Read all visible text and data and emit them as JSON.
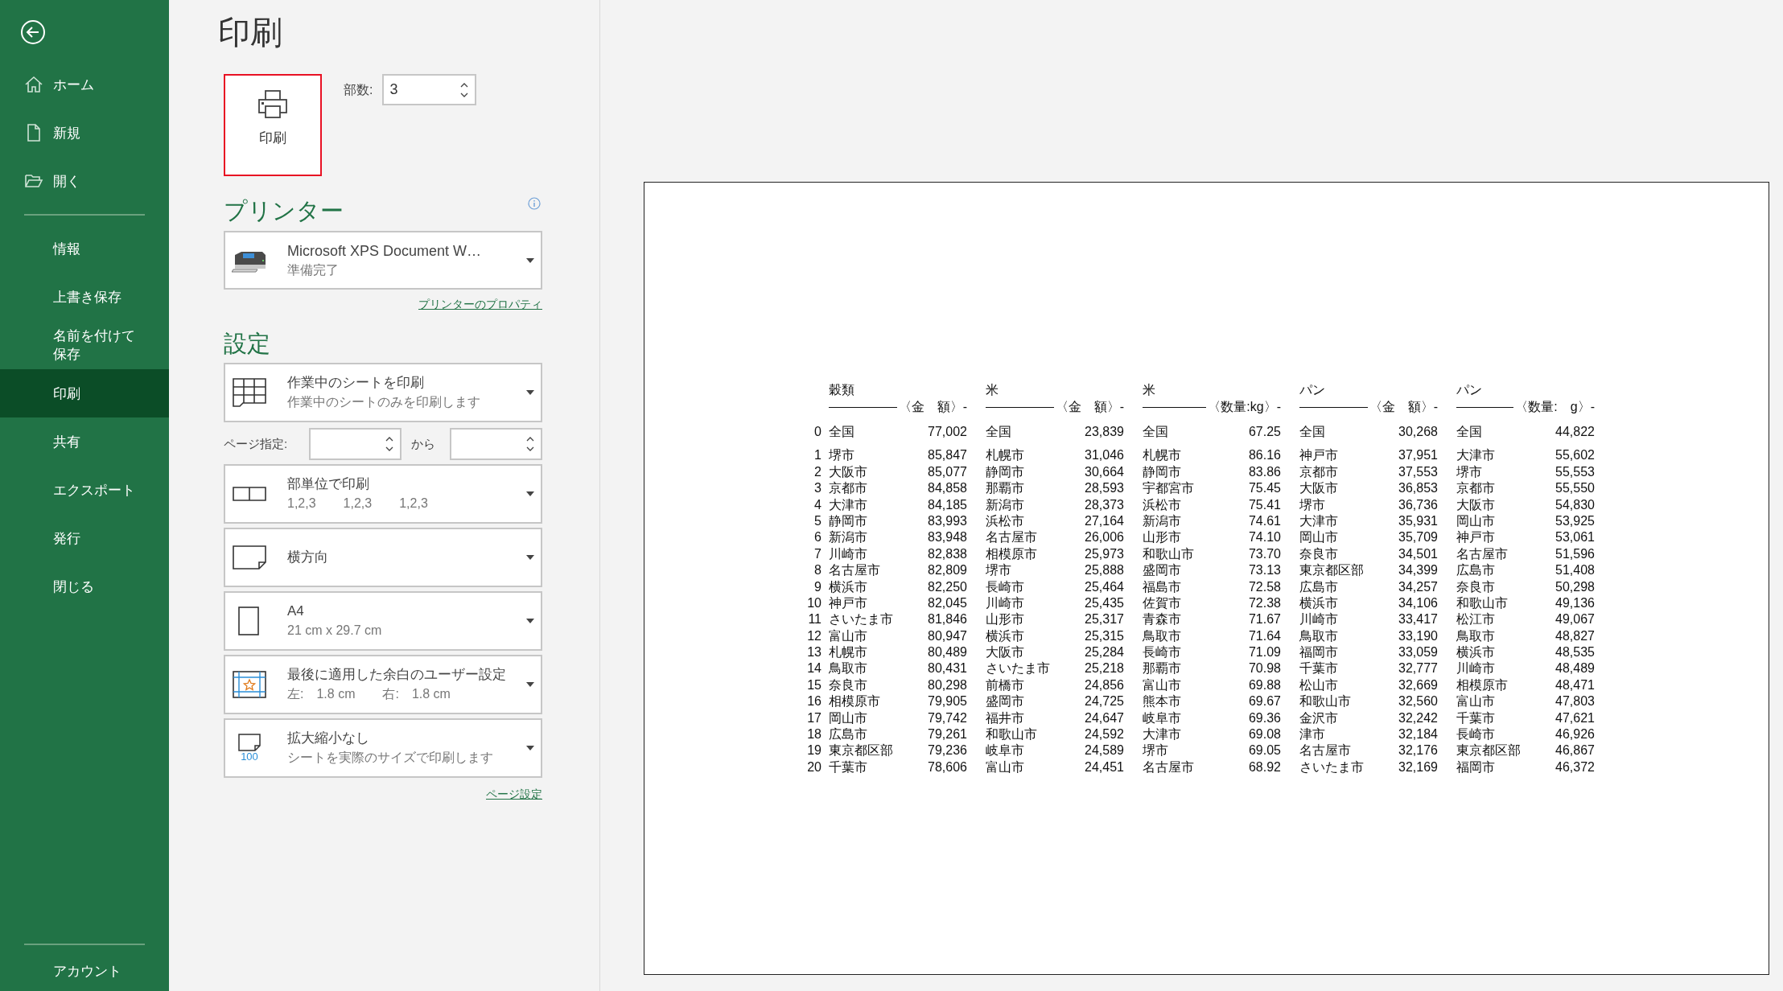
{
  "sidebar": {
    "top_items": [
      {
        "label": "ホーム",
        "kind": "home",
        "selected": false
      },
      {
        "label": "新規",
        "kind": "new",
        "selected": false
      },
      {
        "label": "開く",
        "kind": "open",
        "selected": false
      }
    ],
    "items": [
      {
        "label": "情報",
        "selected": false
      },
      {
        "label": "上書き保存",
        "selected": false
      },
      {
        "label": "名前を付けて保存",
        "selected": false
      },
      {
        "label": "印刷",
        "selected": true
      },
      {
        "label": "共有",
        "selected": false
      },
      {
        "label": "エクスポート",
        "selected": false
      },
      {
        "label": "発行",
        "selected": false
      },
      {
        "label": "閉じる",
        "selected": false
      }
    ],
    "account": "アカウント"
  },
  "title": "印刷",
  "print_button": {
    "label": "印刷"
  },
  "copies": {
    "label": "部数:",
    "value": "3"
  },
  "printer": {
    "heading": "プリンター",
    "name": "Microsoft XPS Document W…",
    "status": "準備完了",
    "properties_link": "プリンターのプロパティ"
  },
  "settings": {
    "heading": "設定",
    "items": [
      {
        "kind": "sheet",
        "title": "作業中のシートを印刷",
        "details": [
          "作業中のシートのみを印刷します"
        ]
      },
      {
        "kind": "range",
        "label": "ページ指定:",
        "separator": "から"
      },
      {
        "kind": "collate",
        "title": "部単位で印刷",
        "details": [
          "1,2,3",
          "1,2,3",
          "1,2,3"
        ]
      },
      {
        "kind": "orientation",
        "title": "横方向"
      },
      {
        "kind": "paper",
        "title": "A4",
        "details": [
          "21 cm x 29.7 cm"
        ]
      },
      {
        "kind": "margins",
        "title": "最後に適用した余白のユーザー設定",
        "details": [
          "左:　1.8 cm",
          "右:　1.8 cm"
        ]
      },
      {
        "kind": "scaling",
        "title": "拡大縮小なし",
        "details": [
          "シートを実際のサイズで印刷します"
        ],
        "badge": "100"
      }
    ],
    "page_setup_link": "ページ設定"
  },
  "preview": {
    "groups": [
      {
        "title": "穀類",
        "measure": "〈金　額〉-"
      },
      {
        "title": "米",
        "measure": "〈金　額〉-"
      },
      {
        "title": "米",
        "measure": "〈数量:kg〉-"
      },
      {
        "title": "パン",
        "measure": "〈金　額〉-"
      },
      {
        "title": "パン",
        "measure": "〈数量:　g〉-"
      }
    ],
    "total": {
      "no": "0",
      "cells": [
        [
          "全国",
          "77,002"
        ],
        [
          "全国",
          "23,839"
        ],
        [
          "全国",
          "67.25"
        ],
        [
          "全国",
          "30,268"
        ],
        [
          "全国",
          "44,822"
        ]
      ]
    },
    "rows": [
      {
        "no": "1",
        "cells": [
          [
            "堺市",
            "85,847"
          ],
          [
            "札幌市",
            "31,046"
          ],
          [
            "札幌市",
            "86.16"
          ],
          [
            "神戸市",
            "37,951"
          ],
          [
            "大津市",
            "55,602"
          ]
        ]
      },
      {
        "no": "2",
        "cells": [
          [
            "大阪市",
            "85,077"
          ],
          [
            "静岡市",
            "30,664"
          ],
          [
            "静岡市",
            "83.86"
          ],
          [
            "京都市",
            "37,553"
          ],
          [
            "堺市",
            "55,553"
          ]
        ]
      },
      {
        "no": "3",
        "cells": [
          [
            "京都市",
            "84,858"
          ],
          [
            "那覇市",
            "28,593"
          ],
          [
            "宇都宮市",
            "75.45"
          ],
          [
            "大阪市",
            "36,853"
          ],
          [
            "京都市",
            "55,550"
          ]
        ]
      },
      {
        "no": "4",
        "cells": [
          [
            "大津市",
            "84,185"
          ],
          [
            "新潟市",
            "28,373"
          ],
          [
            "浜松市",
            "75.41"
          ],
          [
            "堺市",
            "36,736"
          ],
          [
            "大阪市",
            "54,830"
          ]
        ]
      },
      {
        "no": "5",
        "cells": [
          [
            "静岡市",
            "83,993"
          ],
          [
            "浜松市",
            "27,164"
          ],
          [
            "新潟市",
            "74.61"
          ],
          [
            "大津市",
            "35,931"
          ],
          [
            "岡山市",
            "53,925"
          ]
        ]
      },
      {
        "no": "6",
        "cells": [
          [
            "新潟市",
            "83,948"
          ],
          [
            "名古屋市",
            "26,006"
          ],
          [
            "山形市",
            "74.10"
          ],
          [
            "岡山市",
            "35,709"
          ],
          [
            "神戸市",
            "53,061"
          ]
        ]
      },
      {
        "no": "7",
        "cells": [
          [
            "川崎市",
            "82,838"
          ],
          [
            "相模原市",
            "25,973"
          ],
          [
            "和歌山市",
            "73.70"
          ],
          [
            "奈良市",
            "34,501"
          ],
          [
            "名古屋市",
            "51,596"
          ]
        ]
      },
      {
        "no": "8",
        "cells": [
          [
            "名古屋市",
            "82,809"
          ],
          [
            "堺市",
            "25,888"
          ],
          [
            "盛岡市",
            "73.13"
          ],
          [
            "東京都区部",
            "34,399"
          ],
          [
            "広島市",
            "51,408"
          ]
        ]
      },
      {
        "no": "9",
        "cells": [
          [
            "横浜市",
            "82,250"
          ],
          [
            "長崎市",
            "25,464"
          ],
          [
            "福島市",
            "72.58"
          ],
          [
            "広島市",
            "34,257"
          ],
          [
            "奈良市",
            "50,298"
          ]
        ]
      },
      {
        "no": "10",
        "cells": [
          [
            "神戸市",
            "82,045"
          ],
          [
            "川崎市",
            "25,435"
          ],
          [
            "佐賀市",
            "72.38"
          ],
          [
            "横浜市",
            "34,106"
          ],
          [
            "和歌山市",
            "49,136"
          ]
        ]
      },
      {
        "no": "11",
        "cells": [
          [
            "さいたま市",
            "81,846"
          ],
          [
            "山形市",
            "25,317"
          ],
          [
            "青森市",
            "71.67"
          ],
          [
            "川崎市",
            "33,417"
          ],
          [
            "松江市",
            "49,067"
          ]
        ]
      },
      {
        "no": "12",
        "cells": [
          [
            "富山市",
            "80,947"
          ],
          [
            "横浜市",
            "25,315"
          ],
          [
            "鳥取市",
            "71.64"
          ],
          [
            "鳥取市",
            "33,190"
          ],
          [
            "鳥取市",
            "48,827"
          ]
        ]
      },
      {
        "no": "13",
        "cells": [
          [
            "札幌市",
            "80,489"
          ],
          [
            "大阪市",
            "25,284"
          ],
          [
            "長崎市",
            "71.09"
          ],
          [
            "福岡市",
            "33,059"
          ],
          [
            "横浜市",
            "48,535"
          ]
        ]
      },
      {
        "no": "14",
        "cells": [
          [
            "鳥取市",
            "80,431"
          ],
          [
            "さいたま市",
            "25,218"
          ],
          [
            "那覇市",
            "70.98"
          ],
          [
            "千葉市",
            "32,777"
          ],
          [
            "川崎市",
            "48,489"
          ]
        ]
      },
      {
        "no": "15",
        "cells": [
          [
            "奈良市",
            "80,298"
          ],
          [
            "前橋市",
            "24,856"
          ],
          [
            "富山市",
            "69.88"
          ],
          [
            "松山市",
            "32,669"
          ],
          [
            "相模原市",
            "48,471"
          ]
        ]
      },
      {
        "no": "16",
        "cells": [
          [
            "相模原市",
            "79,905"
          ],
          [
            "盛岡市",
            "24,725"
          ],
          [
            "熊本市",
            "69.67"
          ],
          [
            "和歌山市",
            "32,560"
          ],
          [
            "富山市",
            "47,803"
          ]
        ]
      },
      {
        "no": "17",
        "cells": [
          [
            "岡山市",
            "79,742"
          ],
          [
            "福井市",
            "24,647"
          ],
          [
            "岐阜市",
            "69.36"
          ],
          [
            "金沢市",
            "32,242"
          ],
          [
            "千葉市",
            "47,621"
          ]
        ]
      },
      {
        "no": "18",
        "cells": [
          [
            "広島市",
            "79,261"
          ],
          [
            "和歌山市",
            "24,592"
          ],
          [
            "大津市",
            "69.08"
          ],
          [
            "津市",
            "32,184"
          ],
          [
            "長崎市",
            "46,926"
          ]
        ]
      },
      {
        "no": "19",
        "cells": [
          [
            "東京都区部",
            "79,236"
          ],
          [
            "岐阜市",
            "24,589"
          ],
          [
            "堺市",
            "69.05"
          ],
          [
            "名古屋市",
            "32,176"
          ],
          [
            "東京都区部",
            "46,867"
          ]
        ]
      },
      {
        "no": "20",
        "cells": [
          [
            "千葉市",
            "78,606"
          ],
          [
            "富山市",
            "24,451"
          ],
          [
            "名古屋市",
            "68.92"
          ],
          [
            "さいたま市",
            "32,169"
          ],
          [
            "福岡市",
            "46,372"
          ]
        ]
      }
    ]
  }
}
